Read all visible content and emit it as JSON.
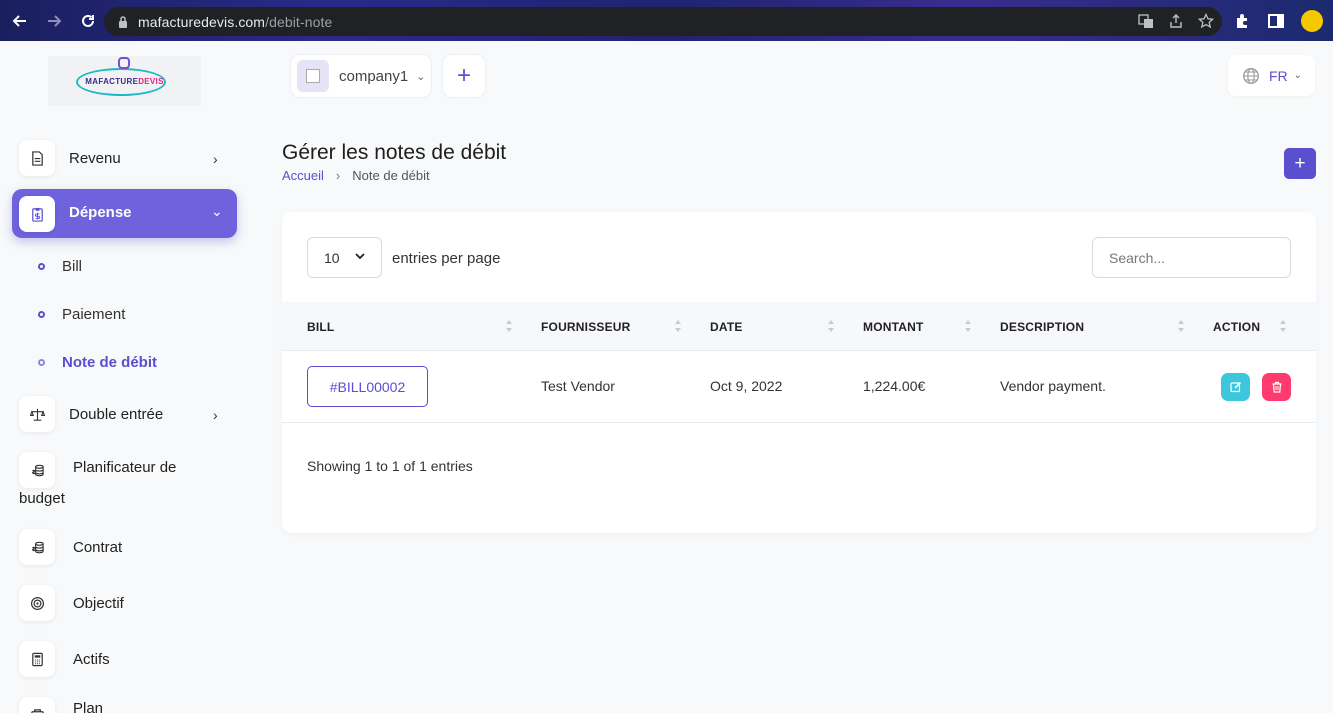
{
  "browser": {
    "url_domain": "mafacturedevis.com",
    "url_path": "/debit-note"
  },
  "logo": {
    "text_main": "MAFACTURE",
    "text_accent": "DEVIS"
  },
  "sidebar": {
    "items": [
      {
        "label": "Revenu"
      },
      {
        "label": "Dépense"
      },
      {
        "label": "Double entrée"
      },
      {
        "label": "Planificateur de"
      },
      {
        "label": "Contrat"
      },
      {
        "label": "Objectif"
      },
      {
        "label": "Actifs"
      },
      {
        "label": "Plan"
      }
    ],
    "budget_line2": "budget",
    "subitems": [
      {
        "label": "Bill"
      },
      {
        "label": "Paiement"
      },
      {
        "label": "Note de débit"
      }
    ]
  },
  "topbar": {
    "company": "company1",
    "add_symbol": "+",
    "language": "FR"
  },
  "page": {
    "title": "Gérer les notes de débit",
    "breadcrumb_home": "Accueil",
    "breadcrumb_current": "Note de débit",
    "add_symbol": "+"
  },
  "table": {
    "per_page_value": "10",
    "per_page_label": "entries per page",
    "search_placeholder": "Search...",
    "headers": [
      "BILL",
      "FOURNISSEUR",
      "DATE",
      "MONTANT",
      "DESCRIPTION",
      "ACTION"
    ],
    "rows": [
      {
        "bill": "#BILL00002",
        "vendor": "Test Vendor",
        "date": "Oct 9, 2022",
        "amount": "1,224.00€",
        "description": "Vendor payment."
      }
    ],
    "footer": "Showing 1 to 1 of 1 entries"
  },
  "colors": {
    "primary": "#5a4fcf",
    "sidebar_active": "#6e62dd",
    "edit_button": "#3ec6dd",
    "delete_button": "#ff3a6e"
  }
}
